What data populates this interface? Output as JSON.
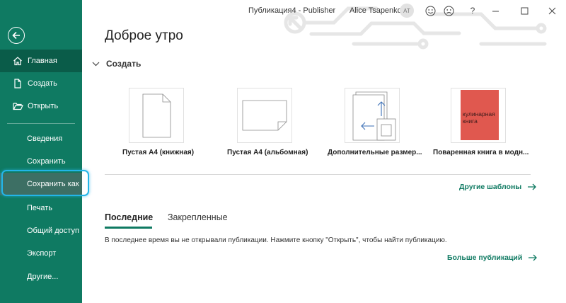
{
  "window": {
    "title": "Публикация4  -  Publisher",
    "user_name": "Alice Tsapenko",
    "user_initials": "AT",
    "controls": {
      "help": "?"
    }
  },
  "sidebar": {
    "items": [
      {
        "label": "Главная",
        "icon": "home-icon"
      },
      {
        "label": "Создать",
        "icon": "new-document-icon"
      },
      {
        "label": "Открыть",
        "icon": "folder-open-icon"
      },
      {
        "label": "Сведения"
      },
      {
        "label": "Сохранить"
      },
      {
        "label": "Сохранить как"
      },
      {
        "label": "Печать"
      },
      {
        "label": "Общий доступ"
      },
      {
        "label": "Экспорт"
      },
      {
        "label": "Другие..."
      }
    ]
  },
  "main": {
    "greeting": "Доброе утро",
    "create_section": "Создать",
    "templates": [
      {
        "label": "Пустая A4 (книжная)"
      },
      {
        "label": "Пустая A4 (альбомная)"
      },
      {
        "label": "Дополнительные размер..."
      },
      {
        "label": "Поваренная книга в модн...",
        "cover_text": "кулинарная книга"
      }
    ],
    "more_templates_link": "Другие шаблоны",
    "tabs": [
      {
        "label": "Последние"
      },
      {
        "label": "Закрепленные"
      }
    ],
    "empty_message": "В последнее время вы не открывали публикации. Нажмите кнопку \"Открыть\", чтобы найти публикацию.",
    "more_publications_link": "Больше публикаций"
  },
  "colors": {
    "sidebar_bg": "#0f7a62",
    "accent": "#0f7a62",
    "highlight_ring": "#23b5e8",
    "cookbook_cover": "#e0584f"
  }
}
